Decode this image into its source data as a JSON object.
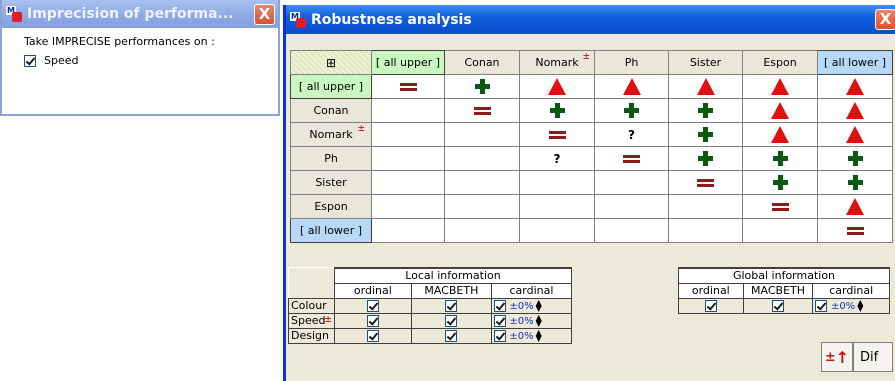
{
  "imprecision_window": {
    "title": "Imprecision of performa...",
    "close_label": "X",
    "prompt": "Take IMPRECISE performances on :",
    "criteria": [
      {
        "label": "Speed",
        "checked": true
      }
    ]
  },
  "robustness_window": {
    "title": "Robustness analysis",
    "close_label": "X",
    "grid_corner_icon": "table-grid-icon",
    "columns": [
      "[ all upper ]",
      "Conan",
      "Nomark",
      "Ph",
      "Sister",
      "Espon",
      "[ all lower ]"
    ],
    "rows": [
      "[ all upper ]",
      "Conan",
      "Nomark",
      "Ph",
      "Sister",
      "Espon",
      "[ all lower ]"
    ],
    "cells": [
      [
        "=",
        "+",
        "▲",
        "▲",
        "▲",
        "▲",
        "▲"
      ],
      [
        "",
        "=",
        "+",
        "+",
        "+",
        "▲",
        "▲"
      ],
      [
        "",
        "",
        "=",
        "?",
        "+",
        "▲",
        "▲"
      ],
      [
        "",
        "",
        "?",
        "=",
        "+",
        "+",
        "+"
      ],
      [
        "",
        "",
        "",
        "",
        "=",
        "+",
        "+"
      ],
      [
        "",
        "",
        "",
        "",
        "",
        "=",
        "▲"
      ],
      [
        "",
        "",
        "",
        "",
        "",
        "",
        "="
      ]
    ],
    "imprecise_marker": "±",
    "local_info": {
      "title": "Local information",
      "headers": [
        "ordinal",
        "MACBETH",
        "cardinal"
      ],
      "rows": [
        {
          "label": "Colour",
          "ordinal": true,
          "macbeth": true,
          "cardinal": true,
          "pct": "±0%"
        },
        {
          "label": "Speed",
          "ordinal": true,
          "macbeth": true,
          "cardinal": true,
          "pct": "±0%"
        },
        {
          "label": "Design",
          "ordinal": true,
          "macbeth": true,
          "cardinal": true,
          "pct": "±0%"
        }
      ]
    },
    "global_info": {
      "title": "Global information",
      "headers": [
        "ordinal",
        "MACBETH",
        "cardinal"
      ],
      "row": {
        "ordinal": true,
        "macbeth": true,
        "cardinal": true,
        "pct": "±0%"
      }
    },
    "buttons": {
      "imprecision_icon": "plus-minus-arrow-icon",
      "imprecision_label": "±",
      "dif_label": "Dif"
    }
  },
  "colors": {
    "equal": "#8c1c1c",
    "plus": "#0c5a12",
    "triangle": "#e01010",
    "upper": "#c8f7c0",
    "lower": "#b7d8f6"
  }
}
